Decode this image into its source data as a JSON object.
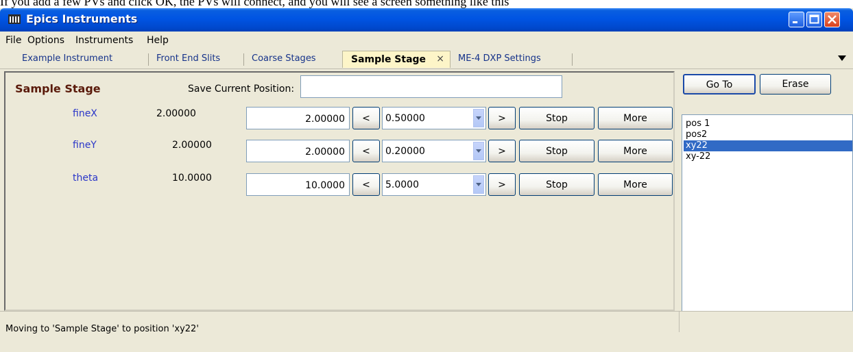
{
  "caption": "If you add a few PVs and click OK, the PVs will connect, and you will see a screen something like this",
  "window": {
    "title": "Epics Instruments"
  },
  "menu": [
    "File",
    "Options",
    "Instruments",
    "Help"
  ],
  "tabs": [
    {
      "label": "Example Instrument"
    },
    {
      "label": "Front End Slits"
    },
    {
      "label": "Coarse Stages"
    },
    {
      "label": "Sample Stage",
      "active": true
    },
    {
      "label": "ME-4 DXP Settings"
    }
  ],
  "tab_close": "×",
  "panel": {
    "title": "Sample Stage",
    "save_label": "Save Current Position:",
    "save_value": ""
  },
  "axes": [
    {
      "name": "fineX",
      "readback": "2.00000",
      "target": "2.00000",
      "step": "0.50000",
      "prev": "<",
      "next": ">",
      "stop": "Stop",
      "more": "More"
    },
    {
      "name": "fineY",
      "readback": "2.00000",
      "target": "2.00000",
      "step": "0.20000",
      "prev": "<",
      "next": ">",
      "stop": "Stop",
      "more": "More"
    },
    {
      "name": "theta",
      "readback": "10.0000",
      "target": "10.0000",
      "step": "5.0000",
      "prev": "<",
      "next": ">",
      "stop": "Stop",
      "more": "More"
    }
  ],
  "positions": {
    "goto_label": "Go To",
    "erase_label": "Erase",
    "items": [
      "pos 1",
      "pos2",
      "xy22",
      "xy-22"
    ],
    "selected": "xy22"
  },
  "status": {
    "text": "Moving to 'Sample Stage' to position 'xy22'"
  },
  "colors": {
    "titlebar": "#0054e3",
    "selection": "#316ac5",
    "active_tab": "#fdf5c8",
    "axis_name": "#2a36c8"
  }
}
